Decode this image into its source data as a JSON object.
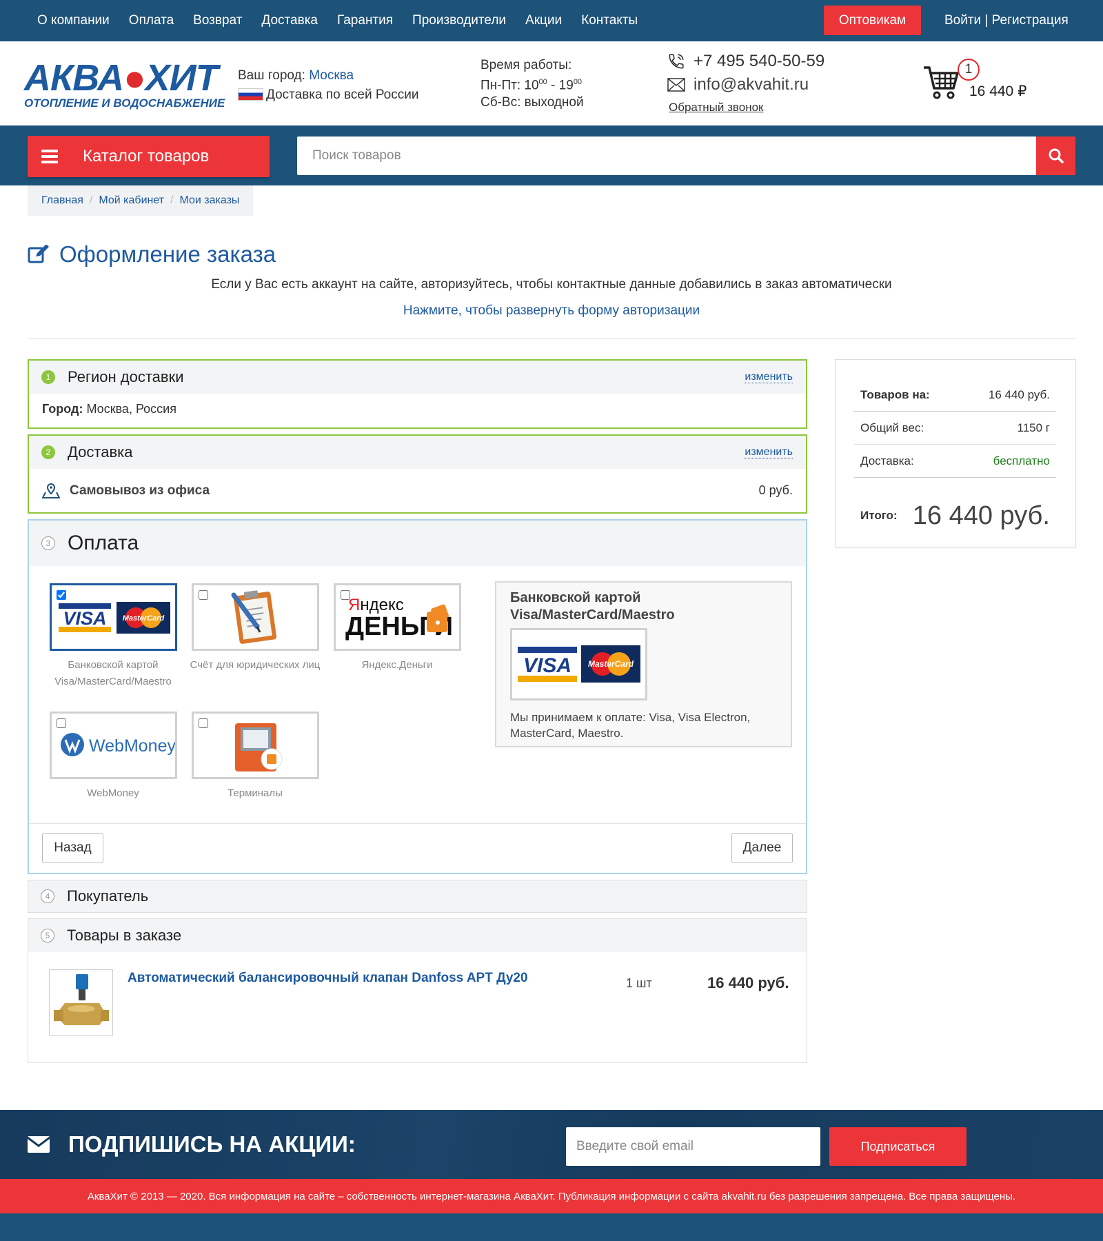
{
  "topnav": {
    "items": [
      "О компании",
      "Оплата",
      "Возврат",
      "Доставка",
      "Гарантия",
      "Производители",
      "Акции",
      "Контакты"
    ],
    "wholesale": "Оптовикам",
    "login": "Войти | Регистрация"
  },
  "header": {
    "logo_left": "АКВА",
    "logo_right": "ХИТ",
    "logo_sub": "ОТОПЛЕНИЕ И ВОДОСНАБЖЕНИЕ",
    "city_label": "Ваш город:",
    "city": "Москва",
    "delivery": "Доставка по всей России",
    "hours_title": "Время работы:",
    "hours_weekdays_prefix": "Пн-Пт: 10",
    "hours_open_sup": "00",
    "hours_dash": " - 19",
    "hours_close_sup": "00",
    "hours_weekend": "Сб-Вс: выходной",
    "phone": "+7 495 540-50-59",
    "email": "info@akvahit.ru",
    "callback": "Обратный звонок",
    "cart_count": "1",
    "cart_sum": "16 440 ₽"
  },
  "search": {
    "catalog_label": "Каталог товаров",
    "placeholder": "Поиск товаров"
  },
  "breadcrumb": [
    "Главная",
    "Мой кабинет",
    "Мои заказы"
  ],
  "page": {
    "title": "Оформление заказа",
    "auth_note": "Если у Вас есть аккаунт на сайте, авторизуйтесь, чтобы контактные данные добавились в заказ автоматически",
    "auth_link": "Нажмите, чтобы развернуть форму авторизации"
  },
  "sections": {
    "region": {
      "num": "1",
      "title": "Регион доставки",
      "change": "изменить",
      "city_label": "Город:",
      "city_value": " Москва, Россия"
    },
    "delivery": {
      "num": "2",
      "title": "Доставка",
      "change": "изменить",
      "method": "Самовывоз из офиса",
      "price": "0 руб."
    },
    "payment": {
      "num": "3",
      "title": "Оплата",
      "options": [
        {
          "caption": "Банковской картой Visa/MasterCard/Maestro",
          "checked": true
        },
        {
          "caption": "Счёт для юридических лиц",
          "checked": false
        },
        {
          "caption": "Яндекс.Деньги",
          "checked": false
        },
        {
          "caption": "WebMoney",
          "checked": false
        },
        {
          "caption": "Терминалы",
          "checked": false
        }
      ],
      "desc_title": "Банковской картой Visa/MasterCard/Maestro",
      "desc_text": "Мы принимаем к оплате: Visa, Visa Electron, MasterCard, Maestro.",
      "back": "Назад",
      "next": "Далее"
    },
    "buyer": {
      "num": "4",
      "title": "Покупатель"
    },
    "items": {
      "num": "5",
      "title": "Товары в заказе",
      "product_name": "Автоматический балансировочный клапан Danfoss APT Ду20",
      "qty": "1 шт",
      "price": "16 440 руб."
    }
  },
  "summary": {
    "goods_label": "Товаров на:",
    "goods_value": "16 440 руб.",
    "weight_label": "Общий вес:",
    "weight_value": "1150 г",
    "delivery_label": "Доставка:",
    "delivery_value": "бесплатно",
    "total_label": "Итого:",
    "total_value": "16 440 руб."
  },
  "subscribe": {
    "title": "ПОДПИШИСЬ НА АКЦИИ:",
    "placeholder": "Введите свой email",
    "button": "Подписаться"
  },
  "copyright": "АкваХит © 2013 — 2020. Вся информация на сайте – собственность интернет-магазина АкваХит. Публикация информации с сайта akvahit.ru без разрешения запрещена. Все права защищены.",
  "colors": {
    "navy": "#1d5279",
    "accent_red": "#ec3539",
    "link_blue": "#1d5aa0",
    "done_green": "#8cc63e"
  },
  "icons": [
    "hamburger-icon",
    "search-icon",
    "cart-icon",
    "phone-icon",
    "mail-icon",
    "edit-icon",
    "map-pin-icon",
    "envelope-icon"
  ]
}
